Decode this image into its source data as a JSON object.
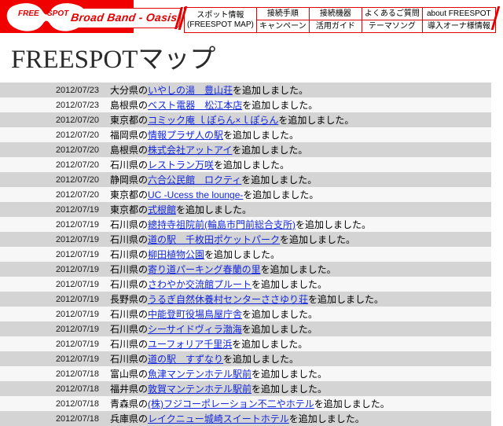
{
  "header": {
    "logo_text_top": "FREE",
    "logo_text_bottom": "SPOT",
    "brand_badge": "Broad Band - Oasis",
    "nav": {
      "spot_line1": "スポット情報",
      "spot_line2": "(FREESPOT MAP)",
      "row1": [
        "接続手順",
        "接続機器",
        "よくあるご質問",
        "about FREESPOT"
      ],
      "row2": [
        "キャンペーン",
        "活用ガイド",
        "テーマソング",
        "導入オーナ様情報"
      ]
    }
  },
  "page_title": "FREESPOTマップ",
  "colors": {
    "brand_red": "#f10000",
    "link_blue": "#1428dc",
    "row_odd": "#d4d4d4",
    "row_even": "#f7f7f7"
  },
  "news": {
    "suffix": "を追加しました。",
    "connector": "の",
    "items": [
      {
        "date": "2012/07/23",
        "pref": "大分県",
        "name": "いやしの湯　豊山荘"
      },
      {
        "date": "2012/07/23",
        "pref": "島根県",
        "name": "ベスト電器　松江本店"
      },
      {
        "date": "2012/07/20",
        "pref": "東京都",
        "name": "コミック庵 ｌぽらん×ｌぽらん"
      },
      {
        "date": "2012/07/20",
        "pref": "福岡県",
        "name": "情報プラザ人の駅"
      },
      {
        "date": "2012/07/20",
        "pref": "島根県",
        "name": "株式会社アットアイ"
      },
      {
        "date": "2012/07/20",
        "pref": "石川県",
        "name": "レストラン万咲"
      },
      {
        "date": "2012/07/20",
        "pref": "静岡県",
        "name": "六合公民館　ロクティ"
      },
      {
        "date": "2012/07/20",
        "pref": "東京都",
        "name": "UC -Ucess the lounge-"
      },
      {
        "date": "2012/07/19",
        "pref": "東京都",
        "name": "式根館"
      },
      {
        "date": "2012/07/19",
        "pref": "石川県",
        "name": "總持寺祖院前(輪島市門前総合支所)"
      },
      {
        "date": "2012/07/19",
        "pref": "石川県",
        "name": "道の駅　千枚田ポケットパーク"
      },
      {
        "date": "2012/07/19",
        "pref": "石川県",
        "name": "柳田植物公園"
      },
      {
        "date": "2012/07/19",
        "pref": "石川県",
        "name": "寄り道パーキング春蘭の里"
      },
      {
        "date": "2012/07/19",
        "pref": "石川県",
        "name": "さわやか交流館プルート"
      },
      {
        "date": "2012/07/19",
        "pref": "長野県",
        "name": "うるぎ自然休養村センターささゆり荘"
      },
      {
        "date": "2012/07/19",
        "pref": "石川県",
        "name": "中能登町役場鳥屋庁舎"
      },
      {
        "date": "2012/07/19",
        "pref": "石川県",
        "name": "シーサイドヴィラ渤海"
      },
      {
        "date": "2012/07/19",
        "pref": "石川県",
        "name": "ユーフォリア千里浜"
      },
      {
        "date": "2012/07/19",
        "pref": "石川県",
        "name": "道の駅　すずなり"
      },
      {
        "date": "2012/07/18",
        "pref": "富山県",
        "name": "魚津マンテンホテル駅前"
      },
      {
        "date": "2012/07/18",
        "pref": "福井県",
        "name": "敦賀マンテンホテル駅前"
      },
      {
        "date": "2012/07/18",
        "pref": "青森県",
        "name": "(株)フジコーポレーション不二やホテル"
      },
      {
        "date": "2012/07/18",
        "pref": "兵庫県",
        "name": "レイクニュー城崎スイートホテル"
      }
    ]
  }
}
